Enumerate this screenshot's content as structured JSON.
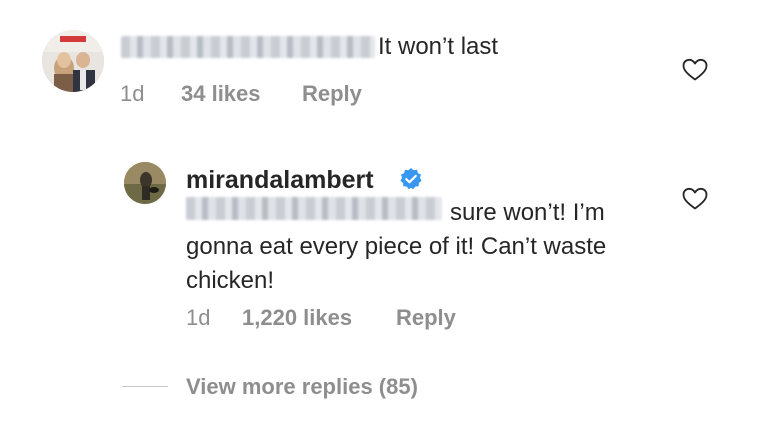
{
  "comments": [
    {
      "text": "It won’t last",
      "time": "1d",
      "likes": "34 likes",
      "reply_label": "Reply"
    }
  ],
  "reply": {
    "username": "mirandalambert",
    "text": "sure won’t! I’m gonna eat every piece of it! Can’t waste chicken!",
    "time": "1d",
    "likes": "1,220 likes",
    "reply_label": "Reply"
  },
  "view_more": "View more replies (85)",
  "colors": {
    "text_primary": "#262626",
    "text_secondary": "#8e8e8e",
    "verified": "#3897f0",
    "divider": "#c7c7c7"
  },
  "icons": [
    "heart-icon",
    "verified-badge-icon"
  ]
}
